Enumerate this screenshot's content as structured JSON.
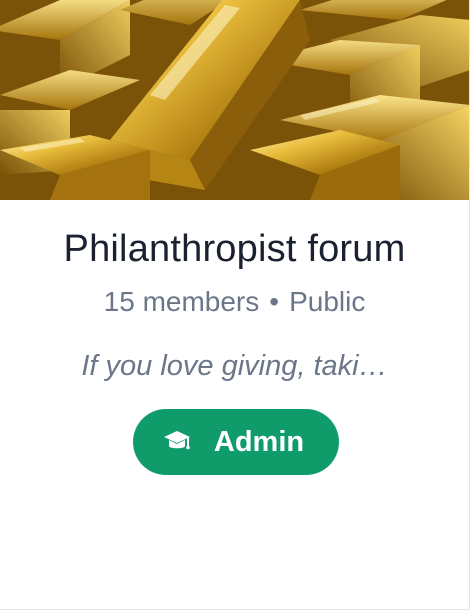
{
  "group": {
    "name": "Philanthropist forum",
    "members": "15 members",
    "separator": "•",
    "visibility": "Public",
    "description": "If you love giving, taki…"
  },
  "cover": {
    "image_subject": "gold bars"
  },
  "admin_button": {
    "label": "Admin",
    "icon": "graduation-cap-icon"
  },
  "colors": {
    "accent": "#0f9b6a",
    "title": "#1b2130",
    "muted": "#6b7789"
  }
}
